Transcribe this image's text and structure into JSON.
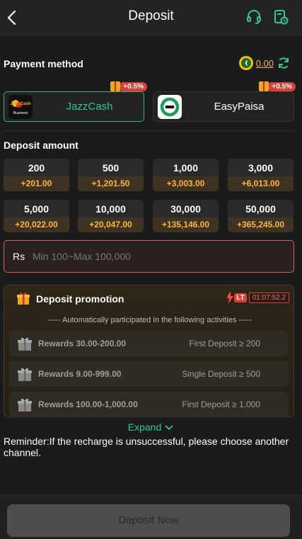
{
  "header": {
    "title": "Deposit"
  },
  "payment": {
    "section_title": "Payment method",
    "balance": "0.00",
    "methods": [
      {
        "name": "JazzCash",
        "bonus": "+0.5%",
        "logo_text": "Jazz Cash",
        "logo_sub": "Business",
        "selected": true
      },
      {
        "name": "EasyPaisa",
        "bonus": "+0.5%",
        "selected": false
      }
    ]
  },
  "deposit_amount": {
    "section_title": "Deposit amount",
    "options": [
      {
        "amount": "200",
        "bonus": "+201.00"
      },
      {
        "amount": "500",
        "bonus": "+1,201.50"
      },
      {
        "amount": "1,000",
        "bonus": "+3,003.00"
      },
      {
        "amount": "3,000",
        "bonus": "+6,013.00"
      },
      {
        "amount": "5,000",
        "bonus": "+20,022.00"
      },
      {
        "amount": "10,000",
        "bonus": "+20,047.00"
      },
      {
        "amount": "30,000",
        "bonus": "+135,146.00"
      },
      {
        "amount": "50,000",
        "bonus": "+365,245.00"
      }
    ],
    "currency_symbol": "Rs",
    "placeholder": "Min 100~Max 100,000",
    "value": ""
  },
  "promotion": {
    "title": "Deposit promotion",
    "timer_badge": "LT",
    "countdown": "01:07:52.2",
    "note": "----- Automatically participated in the following activities -----",
    "rewards": [
      {
        "text": "Rewards 30.00-200.00",
        "condition": "First Deposit ≥ 200"
      },
      {
        "text": "Rewards 9.00-999.00",
        "condition": "Single Deposit ≥ 500"
      },
      {
        "text": "Rewards 100.00-1,000.00",
        "condition": "First Deposit ≥ 1,000"
      }
    ]
  },
  "expand_label": "Expand",
  "reminder": "Reminder:If the recharge is unsuccessful, please choose another channel.",
  "footer": {
    "deposit_button": "Deposit Now"
  },
  "colors": {
    "accent_green": "#2ec98f",
    "bonus_orange": "#ffb63b",
    "badge_red": "#d6423a",
    "input_border": "#d85c64"
  }
}
